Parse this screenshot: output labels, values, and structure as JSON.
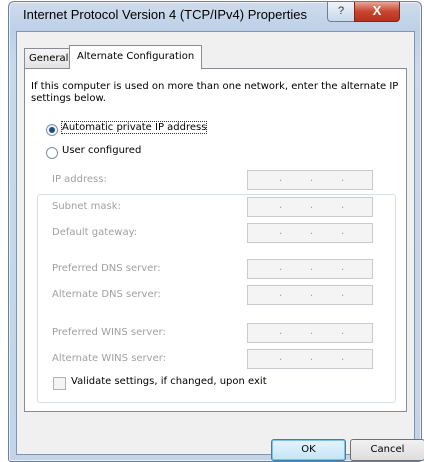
{
  "window": {
    "title": "Internet Protocol Version 4 (TCP/IPv4) Properties",
    "help_label": "?",
    "close_label": "X"
  },
  "tabs": [
    {
      "label": "General",
      "selected": false
    },
    {
      "label": "Alternate Configuration",
      "selected": true
    }
  ],
  "description": "If this computer is used on more than one network, enter the alternate IP settings below.",
  "options": {
    "automatic": {
      "label": "Automatic private IP address",
      "checked": true
    },
    "user": {
      "label": "User configured",
      "checked": false
    }
  },
  "fields": [
    {
      "label": "IP address:",
      "value": ". . ."
    },
    {
      "label": "Subnet mask:",
      "value": ". . ."
    },
    {
      "label": "Default gateway:",
      "value": ". . ."
    },
    {
      "label": "Preferred DNS server:",
      "value": ". . ."
    },
    {
      "label": "Alternate DNS server:",
      "value": ". . ."
    },
    {
      "label": "Preferred WINS server:",
      "value": ". . ."
    },
    {
      "label": "Alternate WINS server:",
      "value": ". . ."
    }
  ],
  "validate": {
    "label": "Validate settings, if changed, upon exit",
    "checked": false
  },
  "buttons": {
    "ok": "OK",
    "cancel": "Cancel"
  }
}
